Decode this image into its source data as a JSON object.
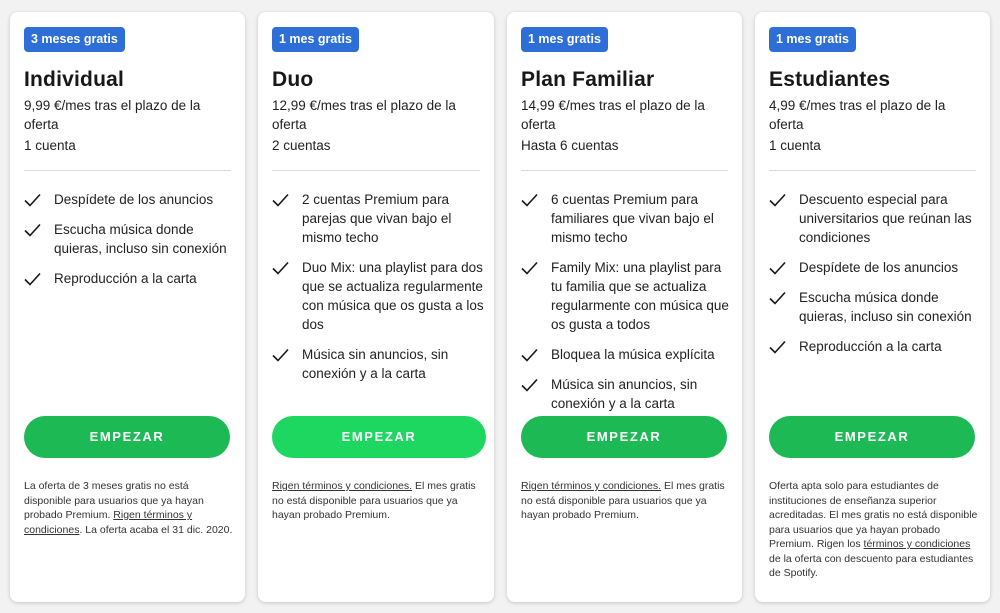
{
  "colors": {
    "badge": "#2d6fd6",
    "cta": "#1db954",
    "cta_hover": "#1ed760",
    "background": "#f2f2f2"
  },
  "plans": [
    {
      "badge": "3 meses gratis",
      "name": "Individual",
      "price": "9,99 €/mes tras el plazo de la oferta",
      "accounts": "1 cuenta",
      "features": [
        "Despídete de los anuncios",
        "Escucha música donde quieras, incluso sin conexión",
        "Reproducción a la carta"
      ],
      "cta": "EMPEZAR",
      "fine_pre": "La oferta de 3 meses gratis no está disponible para usuarios que ya hayan probado Premium. ",
      "fine_link": "Rigen términos y condiciones",
      "fine_post": ". La oferta acaba el 31 dic. 2020."
    },
    {
      "badge": "1 mes gratis",
      "name": "Duo",
      "price": "12,99 €/mes tras el plazo de la oferta",
      "accounts": "2 cuentas",
      "features": [
        "2 cuentas Premium para parejas que vivan bajo el mismo techo",
        "Duo Mix: una playlist para dos que se actualiza regularmente con música que os gusta a los dos",
        "Música sin anuncios, sin conexión y a la carta"
      ],
      "cta": "EMPEZAR",
      "fine_pre": "",
      "fine_link": "Rigen términos y condiciones.",
      "fine_post": " El mes gratis no está disponible para usuarios que ya hayan probado Premium."
    },
    {
      "badge": "1 mes gratis",
      "name": "Plan Familiar",
      "price": "14,99 €/mes tras el plazo de la oferta",
      "accounts": "Hasta 6 cuentas",
      "features": [
        "6 cuentas Premium para familiares que vivan bajo el mismo techo",
        "Family Mix: una playlist para tu familia que se actualiza regularmente con música que os gusta a todos",
        "Bloquea la música explícita",
        "Música sin anuncios, sin conexión y a la carta"
      ],
      "cta": "EMPEZAR",
      "fine_pre": "",
      "fine_link": "Rigen términos y condiciones.",
      "fine_post": " El mes gratis no está disponible para usuarios que ya hayan probado Premium."
    },
    {
      "badge": "1 mes gratis",
      "name": "Estudiantes",
      "price": "4,99 €/mes tras el plazo de la oferta",
      "accounts": "1 cuenta",
      "features": [
        "Descuento especial para universitarios que reúnan las condiciones",
        "Despídete de los anuncios",
        "Escucha música donde quieras, incluso sin conexión",
        "Reproducción a la carta"
      ],
      "cta": "EMPEZAR",
      "fine_pre": "Oferta apta solo para estudiantes de instituciones de enseñanza superior acreditadas. El mes gratis no está disponible para usuarios que ya hayan probado Premium. Rigen los ",
      "fine_link": "términos y condiciones",
      "fine_post": " de la oferta con descuento para estudiantes de Spotify."
    }
  ]
}
